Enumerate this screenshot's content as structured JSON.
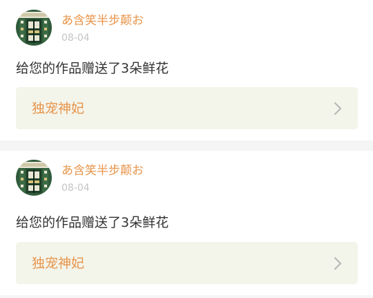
{
  "colors": {
    "accent": "#e8944a",
    "date": "#c4c4c4",
    "text": "#333333",
    "card_bg": "#ffffff",
    "separator": "#f5f5f5",
    "link_bg": "#f3f4ea"
  },
  "notifications": [
    {
      "user": {
        "name": "あ含笑半步颠お",
        "avatar": "avatar-image"
      },
      "date": "08-04",
      "message": "给您的作品赠送了3朵鲜花",
      "work": {
        "title": "独宠神妃",
        "icon": "chevron-right-icon"
      }
    },
    {
      "user": {
        "name": "あ含笑半步颠お",
        "avatar": "avatar-image"
      },
      "date": "08-04",
      "message": "给您的作品赠送了3朵鲜花",
      "work": {
        "title": "独宠神妃",
        "icon": "chevron-right-icon"
      }
    }
  ]
}
